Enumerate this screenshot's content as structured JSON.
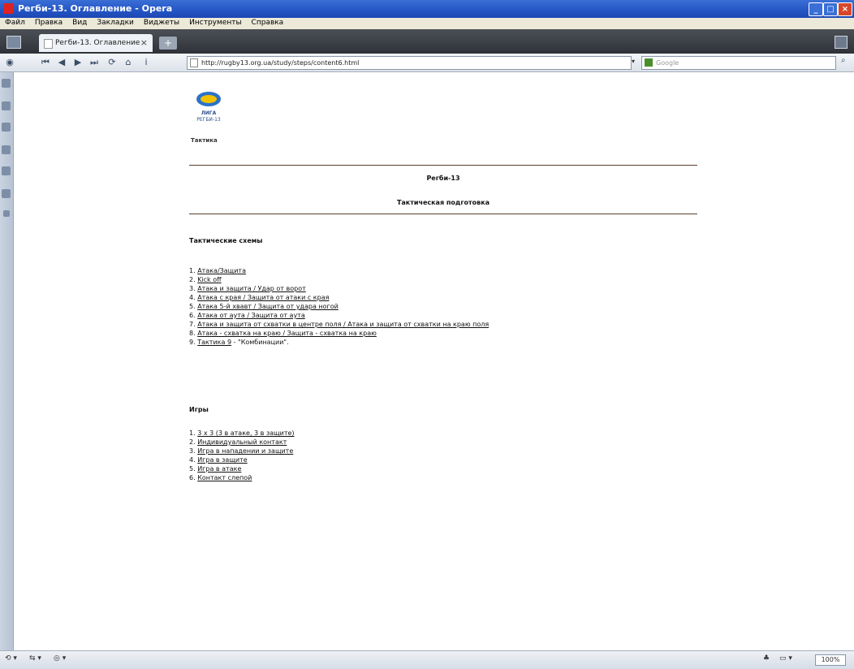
{
  "window": {
    "title": "Регби-13. Оглавление - Opera",
    "minimize": "_",
    "maximize": "□",
    "close": "×"
  },
  "menu": [
    "Файл",
    "Правка",
    "Вид",
    "Закладки",
    "Виджеты",
    "Инструменты",
    "Справка"
  ],
  "tab": {
    "label": "Регби-13. Оглавление",
    "close": "×",
    "new": "+"
  },
  "nav": {
    "rewind": "⏮",
    "back": "◀",
    "forward": "▶",
    "fastforward": "⏭",
    "reload": "⟳",
    "home": "⌂",
    "url": "http://rugby13.org.ua/study/steps/content6.html",
    "url_dropdown": "▾",
    "search_placeholder": "Google",
    "search_go": "⌕"
  },
  "page": {
    "logo_text": "ЛИГА",
    "logo_subtext": "РЕГБИ-13",
    "logo_caption": "Тактика",
    "heading1": "Регби-13",
    "heading2": "Тактическая подготовка",
    "section1_title": "Тактические схемы",
    "section1_items": [
      {
        "num": "1.",
        "text": "Атака/Защита",
        "link": true,
        "suffix": ""
      },
      {
        "num": "2.",
        "text": "Kick off",
        "link": true,
        "suffix": ""
      },
      {
        "num": "3.",
        "text": "Атака и защита / Удар от ворот",
        "link": true,
        "suffix": ""
      },
      {
        "num": "4.",
        "text": "Атака с края / Защита от атаки с края",
        "link": true,
        "suffix": ""
      },
      {
        "num": "5.",
        "text": "Атака 5-й хвавт / Защита от удара ногой",
        "link": true,
        "suffix": ""
      },
      {
        "num": "6.",
        "text": "Атака от аута / Защита от аута",
        "link": true,
        "suffix": ""
      },
      {
        "num": "7.",
        "text": "Атака и защита от схватки в центре поля / Атака и защита от схватки на краю поля",
        "link": true,
        "suffix": ""
      },
      {
        "num": "8.",
        "text": "Атака - схватка на краю / Защита - схватка на краю",
        "link": true,
        "suffix": ""
      },
      {
        "num": "9.",
        "text": "Тактика 9",
        "link": true,
        "suffix": " - \"Комбинации\"."
      }
    ],
    "section2_title": "Игры",
    "section2_items": [
      {
        "num": "1.",
        "text": "3 x 3 (3 в атаке, 3 в защите)",
        "link": true
      },
      {
        "num": "2.",
        "text": "Индивидуальный контакт",
        "link": true
      },
      {
        "num": "3.",
        "text": "Игра в нападении и защите",
        "link": true
      },
      {
        "num": "4.",
        "text": "Игра в защите",
        "link": true
      },
      {
        "num": "5.",
        "text": "Игра в атаке",
        "link": true
      },
      {
        "num": "6.",
        "text": "Контакт слепой",
        "link": true
      }
    ]
  },
  "status": {
    "left1": "⟲ ▾",
    "left2": "⇆ ▾",
    "left3": "◎ ▾",
    "zoom": "100%",
    "right_icon1": "♣",
    "right_icon2": "▭ ▾"
  },
  "colors": {
    "titlebar": "#2454c4",
    "rule": "#5a3e2e",
    "link": "#111111"
  }
}
